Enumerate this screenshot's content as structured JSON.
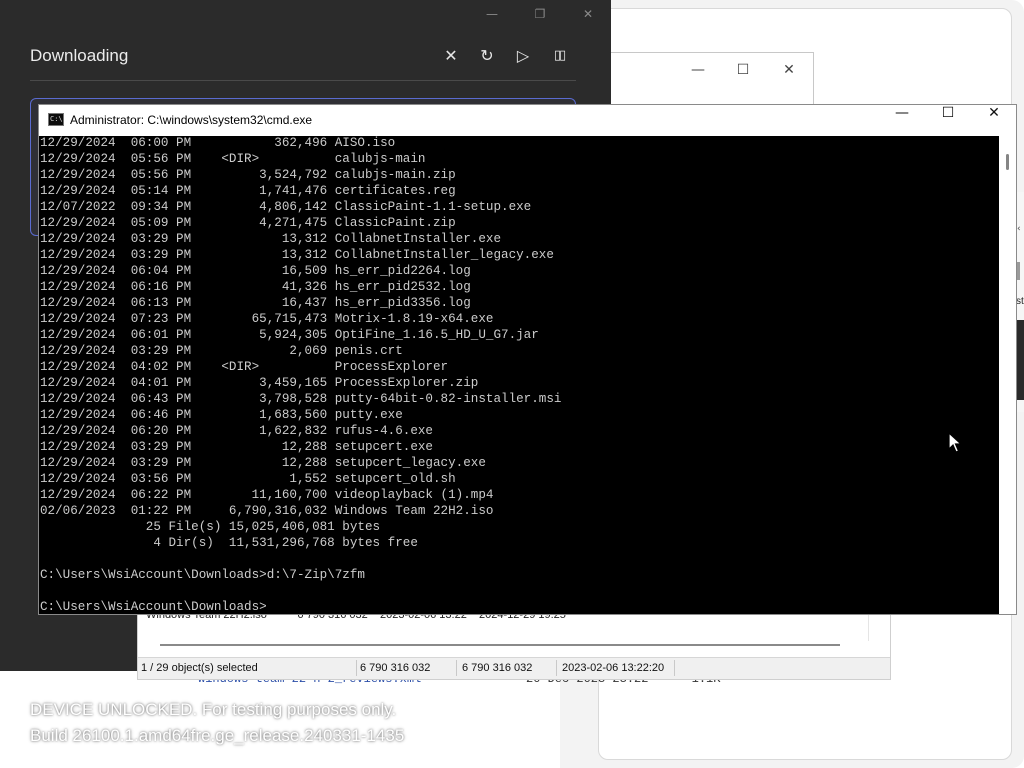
{
  "download_dialog": {
    "title": "Downloading",
    "window_controls": [
      "minimize",
      "maximize",
      "close"
    ],
    "actions": [
      {
        "name": "cancel",
        "icon": "close-icon",
        "glyph": "✕"
      },
      {
        "name": "retry",
        "icon": "refresh-icon",
        "glyph": "↻"
      },
      {
        "name": "resume",
        "icon": "play-icon",
        "glyph": "▷"
      },
      {
        "name": "pause",
        "icon": "pause-icon",
        "glyph": "▯▯"
      }
    ]
  },
  "cmd": {
    "title": "Administrator: C:\\windows\\system32\\cmd.exe",
    "icon_text": "C:\\",
    "controls": {
      "minimize": "—",
      "maximize": "☐",
      "close": "✕"
    },
    "lines": [
      "12/29/2024  06:00 PM           362,496 AISO.iso",
      "12/29/2024  05:56 PM    <DIR>          calubjs-main",
      "12/29/2024  05:56 PM         3,524,792 calubjs-main.zip",
      "12/29/2024  05:14 PM         1,741,476 certificates.reg",
      "12/07/2022  09:34 PM         4,806,142 ClassicPaint-1.1-setup.exe",
      "12/29/2024  05:09 PM         4,271,475 ClassicPaint.zip",
      "12/29/2024  03:29 PM            13,312 CollabnetInstaller.exe",
      "12/29/2024  03:29 PM            13,312 CollabnetInstaller_legacy.exe",
      "12/29/2024  06:04 PM            16,509 hs_err_pid2264.log",
      "12/29/2024  06:16 PM            41,326 hs_err_pid2532.log",
      "12/29/2024  06:13 PM            16,437 hs_err_pid3356.log",
      "12/29/2024  07:23 PM        65,715,473 Motrix-1.8.19-x64.exe",
      "12/29/2024  06:01 PM         5,924,305 OptiFine_1.16.5_HD_U_G7.jar",
      "12/29/2024  03:29 PM             2,069 penis.crt",
      "12/29/2024  04:02 PM    <DIR>          ProcessExplorer",
      "12/29/2024  04:01 PM         3,459,165 ProcessExplorer.zip",
      "12/29/2024  06:43 PM         3,798,528 putty-64bit-0.82-installer.msi",
      "12/29/2024  06:46 PM         1,683,560 putty.exe",
      "12/29/2024  06:20 PM         1,622,832 rufus-4.6.exe",
      "12/29/2024  03:29 PM            12,288 setupcert.exe",
      "12/29/2024  03:29 PM            12,288 setupcert_legacy.exe",
      "12/29/2024  03:56 PM             1,552 setupcert_old.sh",
      "12/29/2024  06:22 PM        11,160,700 videoplayback (1).mp4",
      "02/06/2023  01:22 PM     6,790,316,032 Windows Team 22H2.iso",
      "              25 File(s) 15,025,406,081 bytes",
      "               4 Dir(s)  11,531,296,768 bytes free",
      "",
      "C:\\Users\\WsiAccount\\Downloads>d:\\7-Zip\\7zfm",
      "",
      "C:\\Users\\WsiAccount\\Downloads>"
    ]
  },
  "file_manager": {
    "row_text": "Windows Team 22H2.iso          6 790 316 032    2023-02-06 13:22    2024-12-29 19:25",
    "status": {
      "selected": "1 / 29 object(s) selected",
      "size": "6 790 316 032",
      "packed": "6 790 316 032",
      "modified": "2023-02-06 13:22:20"
    }
  },
  "background_listing": {
    "name": "windows-team-22-h-2_reviews.xml",
    "date_size": "20-Dec-2023 23:22      1.1K"
  },
  "watermark": {
    "line1": "DEVICE UNLOCKED. For testing purposes only.",
    "line2": "Build 26100.1.amd64fre.ge_release.240331-1435"
  },
  "colors": {
    "dialog_bg": "#2b2b2b",
    "dialog_accent": "#5a6bd0",
    "console_bg": "#000000",
    "console_text": "#cccccc"
  }
}
